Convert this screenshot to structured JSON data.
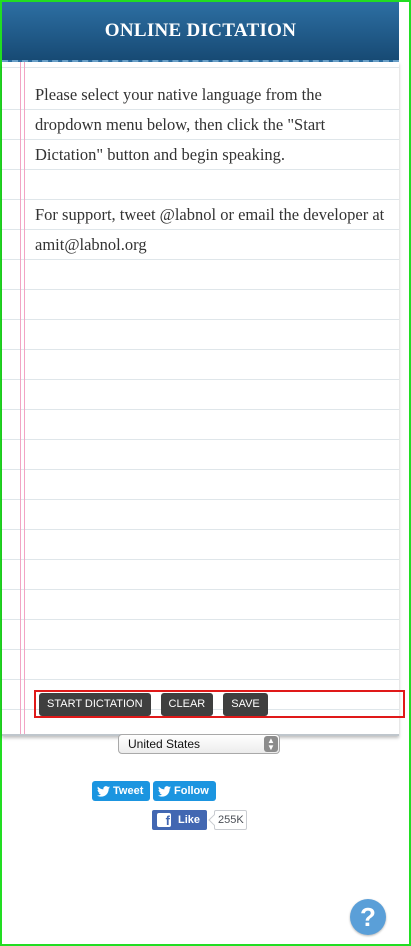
{
  "header": {
    "title": "ONLINE DICTATION"
  },
  "paper": {
    "instructions": "Please select your native language from the dropdown menu below, then click the \"Start Dictation\" button and begin speaking.",
    "support": "For support, tweet @labnol or email the developer at amit@labnol.org"
  },
  "toolbar": {
    "start_label": "START DICTATION",
    "clear_label": "CLEAR",
    "save_label": "SAVE"
  },
  "language_select": {
    "selected": "United States"
  },
  "social": {
    "tweet_label": "Tweet",
    "follow_label": "Follow",
    "like_label": "Like",
    "like_count": "255K"
  },
  "colors": {
    "header": "#1f5a8a",
    "button": "#3f3f3f",
    "twitter": "#1b95e0",
    "facebook": "#4267b2",
    "help": "#5a9fd8",
    "highlight_box": "#e01919"
  },
  "icons": {
    "twitter": "twitter-bird-icon",
    "facebook": "facebook-f-icon",
    "help": "question-mark-icon",
    "select_arrows": "updown-arrows-icon"
  }
}
